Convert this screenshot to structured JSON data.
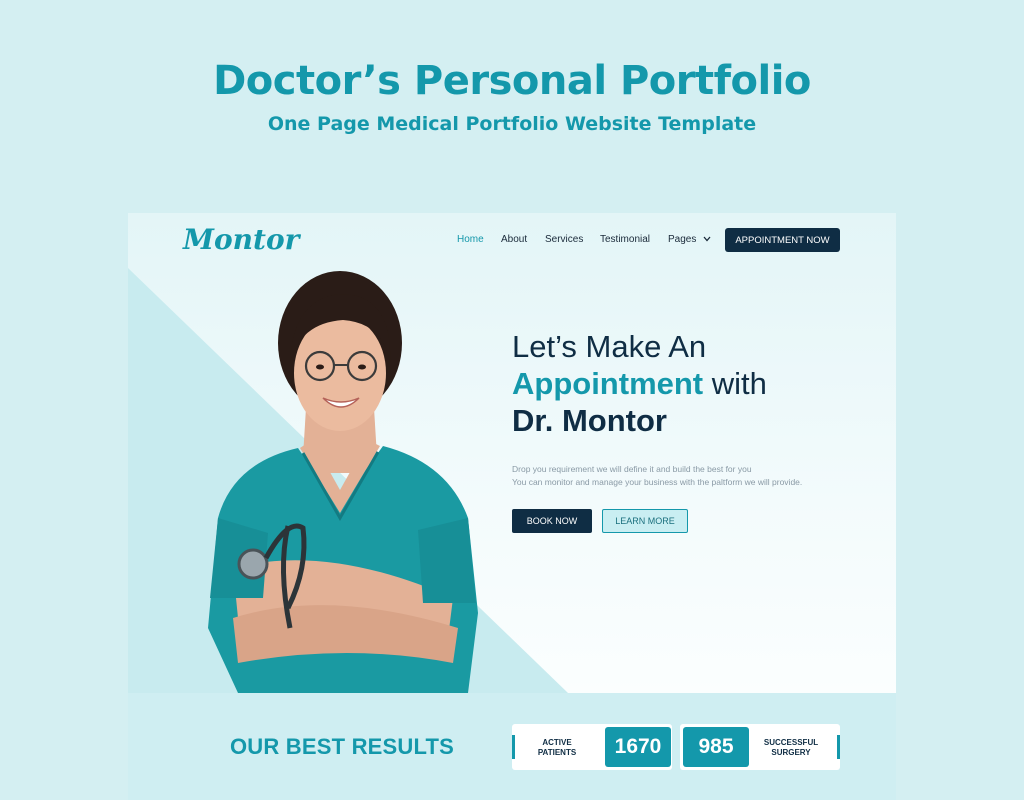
{
  "banner": {
    "title": "Doctor’s Personal Portfolio",
    "subtitle": "One Page Medical Portfolio Website Template"
  },
  "header": {
    "logo": "Montor",
    "nav": [
      {
        "label": "Home",
        "active": true
      },
      {
        "label": "About"
      },
      {
        "label": "Services"
      },
      {
        "label": "Testimonial"
      },
      {
        "label": "Pages",
        "icon": "chevron-down-icon"
      }
    ],
    "cta_label": "APPOINTMENT NOW"
  },
  "hero": {
    "line1": "Let’s Make An",
    "accent": "Appointment",
    "with": " with",
    "name": "Dr. Montor",
    "desc_line1": "Drop you requirement we will define it and build the best for you",
    "desc_line2": "You can monitor and manage your business with the paltform we will provide.",
    "book_label": "BOOK NOW",
    "learn_label": "LEARN MORE"
  },
  "results": {
    "title": "OUR BEST RESULTS",
    "stats": [
      {
        "label_line1": "ACTIVE",
        "label_line2": "PATIENTS",
        "value": "1670"
      },
      {
        "label_line1": "SUCCESSFUL",
        "label_line2": "SURGERY",
        "value": "985"
      }
    ]
  },
  "colors": {
    "accent": "#1498ab",
    "dark": "#0f2d44",
    "background": "#d4eff2"
  }
}
